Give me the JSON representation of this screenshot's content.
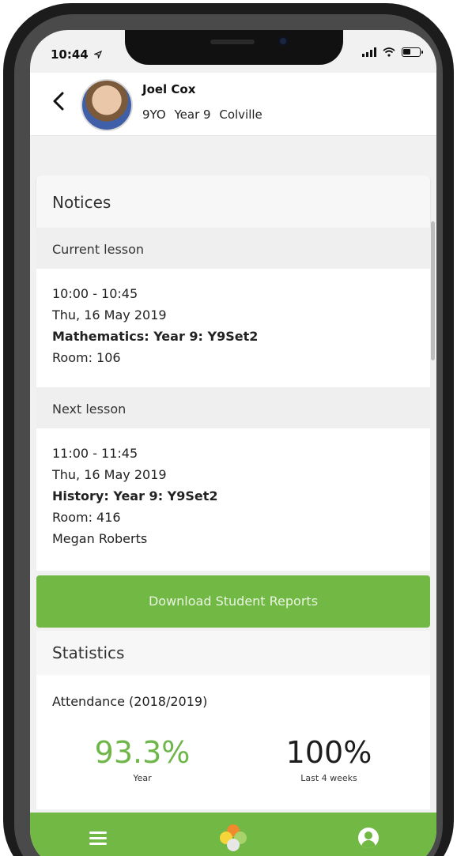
{
  "status_bar": {
    "time": "10:44",
    "location_icon": "location-arrow-icon",
    "signal_icon": "signal-icon",
    "wifi_icon": "wifi-icon",
    "battery_icon": "battery-icon"
  },
  "header": {
    "back_icon": "chevron-left-icon",
    "student_name": "Joel Cox",
    "form": "9YO",
    "year": "Year 9",
    "house": "Colville"
  },
  "notices": {
    "title": "Notices"
  },
  "current_lesson": {
    "label": "Current lesson",
    "time": "10:00 - 10:45",
    "date": "Thu, 16 May 2019",
    "subject": "Mathematics: Year 9: Y9Set2",
    "room": "Room: 106"
  },
  "next_lesson": {
    "label": "Next lesson",
    "time": "11:00 - 11:45",
    "date": "Thu, 16 May 2019",
    "subject": "History: Year 9: Y9Set2",
    "room": "Room: 416",
    "teacher": "Megan Roberts"
  },
  "actions": {
    "download_reports": "Download Student Reports"
  },
  "statistics": {
    "title": "Statistics",
    "attendance_label": "Attendance (2018/2019)",
    "year_value": "93.3%",
    "year_caption": "Year",
    "last4_value": "100%",
    "last4_caption": "Last 4 weeks"
  },
  "bottom_nav": {
    "items": [
      "menu-icon",
      "app-logo-icon",
      "user-account-icon"
    ]
  },
  "colors": {
    "accent_green": "#71b844",
    "stat_green": "#6fb64a"
  }
}
